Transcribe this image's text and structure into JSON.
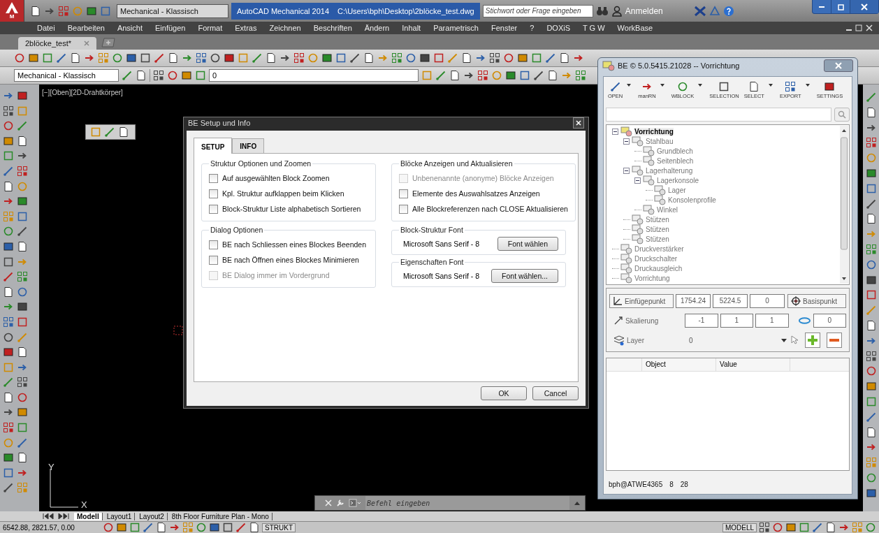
{
  "title_bar": {
    "logo_badge": "M",
    "workspace": "Mechanical - Klassisch",
    "title": "AutoCAD Mechanical 2014",
    "file_path": "C:\\Users\\bph\\Desktop\\2blöcke_test.dwg",
    "search_placeholder": "Stichwort oder Frage eingeben",
    "sign_in": "Anmelden"
  },
  "menu": [
    "Datei",
    "Bearbeiten",
    "Ansicht",
    "Einfügen",
    "Format",
    "Extras",
    "Zeichnen",
    "Beschriften",
    "Ändern",
    "Inhalt",
    "Parametrisch",
    "Fenster",
    "?",
    "DOXiS",
    "T G W",
    "WorkBase"
  ],
  "document_tabs": [
    {
      "label": "2blöcke_test*",
      "selected": true
    }
  ],
  "toolbar": {
    "workspace": "Mechanical - Klassisch",
    "layer": "0"
  },
  "viewport_label": "[−][Oben][2D-Drahtkörper]",
  "ucs": {
    "x_label": "X",
    "y_label": "Y"
  },
  "layout_tabs": [
    {
      "label": "Modell",
      "selected": true
    },
    {
      "label": "Layout1",
      "selected": false
    },
    {
      "label": "Layout2",
      "selected": false
    },
    {
      "label": "8th Floor Furniture Plan - Mono",
      "selected": false
    }
  ],
  "command_line": {
    "placeholder": "Befehl eingeben"
  },
  "status_bar": {
    "coordinates": "6542.88, 2821.57, 0.00",
    "strukt": "STRUKT",
    "model": "MODELL"
  },
  "setup_dialog": {
    "title": "BE Setup und Info",
    "tabs": [
      {
        "label": "SETUP",
        "selected": true
      },
      {
        "label": "INFO",
        "selected": false
      }
    ],
    "groups": [
      {
        "title": "Struktur Optionen und Zoomen",
        "options": [
          {
            "label": "Auf ausgewählten Block Zoomen",
            "checked": false,
            "disabled": false
          },
          {
            "label": "Kpl. Struktur aufklappen beim Klicken",
            "checked": false,
            "disabled": false
          },
          {
            "label": "Block-Struktur Liste alphabetisch Sortieren",
            "checked": false,
            "disabled": false
          }
        ]
      },
      {
        "title": "Blöcke Anzeigen und Aktualisieren",
        "options": [
          {
            "label": "Unbenenannte (anonyme) Blöcke Anzeigen",
            "checked": false,
            "disabled": true
          },
          {
            "label": "Elemente des Auswahlsatzes Anzeigen",
            "checked": false,
            "disabled": false
          },
          {
            "label": "Alle Blockreferenzen nach CLOSE Aktualisieren",
            "checked": false,
            "disabled": false
          }
        ]
      },
      {
        "title": "Dialog Optionen",
        "options": [
          {
            "label": "BE nach Schliessen eines Blockes Beenden",
            "checked": false,
            "disabled": false
          },
          {
            "label": "BE nach Öffnen eines Blockes Minimieren",
            "checked": false,
            "disabled": false
          },
          {
            "label": "BE Dialog immer im Vordergrund",
            "checked": false,
            "disabled": true
          }
        ]
      }
    ],
    "fonts": [
      {
        "title": "Block-Struktur Font",
        "value": "Microsoft Sans Serif - 8",
        "button": "Font wählen"
      },
      {
        "title": "Eigenschaften Font",
        "value": "Microsoft Sans Serif - 8",
        "button": "Font wählen..."
      }
    ],
    "buttons": [
      "OK",
      "Cancel"
    ]
  },
  "be_panel": {
    "title": "BE © 5.0.5415.21028 -- Vorrichtung",
    "tools": [
      {
        "label": "OPEN",
        "has_menu": true
      },
      {
        "label": "manRN",
        "has_menu": true
      },
      {
        "label": "WBLOCK",
        "has_menu": true
      },
      {
        "label": "SELECTION",
        "has_menu": false
      },
      {
        "label": "SELECT",
        "has_menu": true
      },
      {
        "label": "EXPORT",
        "has_menu": true
      },
      {
        "label": "SETTINGS",
        "has_menu": false
      }
    ],
    "tree": [
      {
        "label": "Vorrichtung",
        "selected": true,
        "expanded": true,
        "children": [
          {
            "label": "Stahlbau",
            "selected": false,
            "expanded": true,
            "children": [
              {
                "label": "Grundblech",
                "selected": false
              },
              {
                "label": "Seitenblech",
                "selected": false
              }
            ]
          },
          {
            "label": "Lagerhalterung",
            "selected": false,
            "expanded": true,
            "children": [
              {
                "label": "Lagerkonsole",
                "selected": false,
                "expanded": true,
                "children": [
                  {
                    "label": "Lager",
                    "selected": false
                  },
                  {
                    "label": "Konsolenprofile",
                    "selected": false
                  }
                ]
              },
              {
                "label": "Winkel",
                "selected": false
              }
            ]
          },
          {
            "label": "Stützen",
            "selected": false
          },
          {
            "label": "Stützen",
            "selected": false
          },
          {
            "label": "Stützen",
            "selected": false
          }
        ]
      },
      {
        "label": "Druckverstärker",
        "selected": false
      },
      {
        "label": "Druckschalter",
        "selected": false
      },
      {
        "label": "Druckausgleich",
        "selected": false
      },
      {
        "label": "Vorrichtung",
        "selected": false
      }
    ],
    "insert_point": {
      "label": "Einfügepunkt",
      "values": [
        "1754.24",
        "5224.5",
        "0"
      ]
    },
    "base_point": {
      "label": "Basispunkt"
    },
    "scale": {
      "label": "Skalierung",
      "values": [
        "-1",
        "1",
        "1"
      ]
    },
    "rotation": "0",
    "layer": {
      "label": "Layer",
      "value": "0"
    },
    "table_columns": [
      "Object",
      "Value"
    ],
    "status": [
      "bph@ATWE4365",
      "8",
      "28"
    ]
  }
}
